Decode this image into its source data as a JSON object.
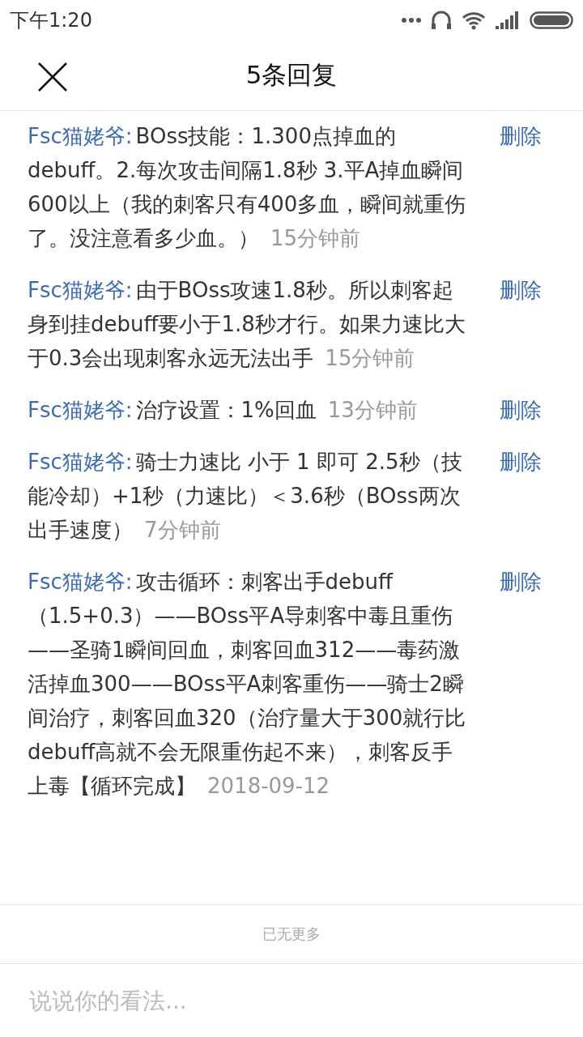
{
  "status_bar": {
    "time": "下午1:20"
  },
  "header": {
    "title": "5条回复"
  },
  "replies": [
    {
      "author": "Fsc猫姥爷:",
      "text": "BOss技能：1.300点掉血的debuff。2.每次攻击间隔1.8秒 3.平A掉血瞬间600以上（我的刺客只有400多血，瞬间就重伤了。没注意看多少血。）",
      "time": "15分钟前",
      "action": "删除"
    },
    {
      "author": "Fsc猫姥爷:",
      "text": "由于BOss攻速1.8秒。所以刺客起身到挂debuff要小于1.8秒才行。如果力速比大于0.3会出现刺客永远无法出手",
      "time": "15分钟前",
      "action": "删除"
    },
    {
      "author": "Fsc猫姥爷:",
      "text": "治疗设置：1%回血",
      "time": "13分钟前",
      "action": "删除"
    },
    {
      "author": "Fsc猫姥爷:",
      "text": "骑士力速比 小于 1 即可 2.5秒（技能冷却）+1秒（力速比）＜3.6秒（BOss两次出手速度）",
      "time": "7分钟前",
      "action": "删除"
    },
    {
      "author": "Fsc猫姥爷:",
      "text": "攻击循环：刺客出手debuff（1.5+0.3）——BOss平A导刺客中毒且重伤——圣骑1瞬间回血，刺客回血312——毒药激活掉血300——BOss平A刺客重伤——骑士2瞬间治疗，刺客回血320（治疗量大于300就行比debuff高就不会无限重伤起不来），刺客反手上毒【循环完成】",
      "time": "2018-09-12",
      "action": "删除"
    }
  ],
  "end_note": "已无更多",
  "comment_input": {
    "placeholder": "说说你的看法..."
  }
}
